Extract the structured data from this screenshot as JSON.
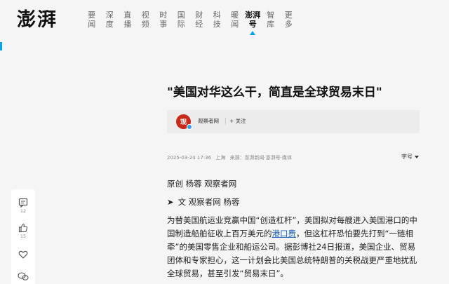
{
  "header": {
    "logo_text": "澎湃",
    "nav": [
      {
        "label_top": "要",
        "label_bottom": "闻",
        "active": false
      },
      {
        "label_top": "深",
        "label_bottom": "度",
        "active": false
      },
      {
        "label_top": "直",
        "label_bottom": "播",
        "active": false
      },
      {
        "label_top": "视",
        "label_bottom": "频",
        "active": false
      },
      {
        "label_top": "时",
        "label_bottom": "事",
        "active": false
      },
      {
        "label_top": "国",
        "label_bottom": "际",
        "active": false
      },
      {
        "label_top": "财",
        "label_bottom": "经",
        "active": false
      },
      {
        "label_top": "科",
        "label_bottom": "技",
        "active": false
      },
      {
        "label_top": "暖",
        "label_bottom": "闻",
        "active": false
      },
      {
        "label_top": "澎湃",
        "label_bottom": "号",
        "active": true
      },
      {
        "label_top": "智",
        "label_bottom": "库",
        "active": false
      },
      {
        "label_top": "更",
        "label_bottom": "多",
        "active": false
      }
    ]
  },
  "article": {
    "title": "\"美国对华这么干，简直是全球贸易末日\"",
    "author": {
      "avatar_text": "观",
      "name": "观察者网",
      "follow_label": "+ 关注"
    },
    "meta": {
      "datetime": "2025-03-24 17:36",
      "location": "上海",
      "source": "来源：澎湃新闻·澎湃号·媒体"
    },
    "font_size_label": "字号",
    "paragraphs": {
      "p1": "原创 杨蓉 观察者网",
      "p2_arrow": "➤",
      "p2": "文 观察者网 杨蓉",
      "p3_a": "为替美国航运业竞赢中国“创造杠杆”，美国拟对每艘进入美国港口的中国制造船舶征收上百万美元的",
      "p3_link": "港口费",
      "p3_b": "，但这杠杆恐怕要先打到“一链相牵”的美国零售企业和船运公司。据彭博社24日报道，美国企业、贸易团体和专家担心，这一计划会比美国总统特朗普的关税战更严重地扰乱全球贸易，甚至引发“贸易末日”。"
    }
  },
  "side_toolbar": {
    "comment_count": "12",
    "like_count": "15"
  },
  "colors": {
    "accent": "#00a5eb",
    "link": "#1a5fb4",
    "avatar_bg": "#c7291b"
  }
}
